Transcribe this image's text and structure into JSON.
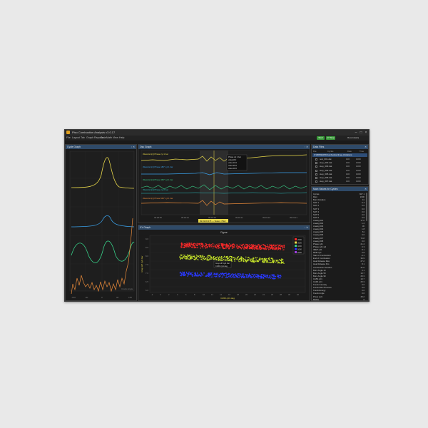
{
  "window": {
    "title": "Piso Combustion Analysis v3.0.17",
    "btn_start": "Start",
    "btn_stop": "17 Stop",
    "btn_recorder": "Recorder[1]"
  },
  "menu": [
    "File",
    "Layout",
    "Tab",
    "Graph Reports",
    "Data",
    "Math",
    "View",
    "Help"
  ],
  "left_panel": {
    "title": "Cycle Graph",
    "x_axis_label": "Crank Angle",
    "x_ticks": [
      "-180",
      "-90",
      "0",
      "90",
      "180"
    ]
  },
  "top_panel": {
    "title": "Osc Graph",
    "legends": [
      "Waveform[1] Phase cyl 1 bar",
      "Waveform[1] Phase 180° cyl 1 bar",
      "Waveform[1] Phase 360° cyl 1 bar",
      "Waveform[1] Phase cyl 2 bar",
      "Waveform[1] Phase 540° cyl 1 bar"
    ],
    "tooltip_lines": [
      "Phase cyl 1 bar",
      "value16.0",
      "value 16.0",
      "value 25.0",
      "value 18.0"
    ],
    "x_ticks": [
      "09:48:56",
      "09:49:01",
      "09:49:06",
      "09:49:11",
      "09:49:16",
      "09:49:21"
    ],
    "status_text": "09:49:06.375 — Status: 78Hz"
  },
  "xy_panel": {
    "title": "XY Graph",
    "chart_title": "Figure",
    "x_axis_label": "CA50 cyl1 deg",
    "y_axis_label": "Imep HP cyl1 bar",
    "legend": [
      "2000",
      "3000",
      "4000",
      "5000",
      "6000"
    ],
    "annotation": [
      "Imep HP cyl1 bar",
      "CA50 cyl1 deg"
    ],
    "y_ticks": [
      "9.0",
      "8.5",
      "8.0",
      "7.5",
      "7.0",
      "6.5",
      "6.0"
    ],
    "x_ticks": [
      "-2",
      "0",
      "2",
      "4",
      "6",
      "8",
      "10",
      "12",
      "14",
      "16",
      "18",
      "20",
      "22",
      "24",
      "26",
      "28",
      "30",
      "32"
    ]
  },
  "data_files": {
    "title": "Data Files",
    "columns": [
      "File",
      "Cycles",
      "Date",
      "Time"
    ],
    "folder": "C:\\RDS\\DATA\\Combustion\\Imep_Rotations",
    "files": [
      {
        "name": "test_001.dat",
        "cycles": "100",
        "box": "1000"
      },
      {
        "name": "step_002.dat",
        "cycles": "100",
        "box": "1000"
      },
      {
        "name": "step_003.dat",
        "cycles": "100",
        "box": "1000"
      },
      {
        "name": "step_004.dat",
        "cycles": "100",
        "box": "1000"
      },
      {
        "name": "step_005.dat",
        "cycles": "100",
        "box": "1000"
      },
      {
        "name": "step_006.dat",
        "cycles": "100",
        "box": "1000"
      },
      {
        "name": "step_007.dat",
        "cycles": "100",
        "box": "1000"
      }
    ]
  },
  "channels": {
    "title": "Main Values for Cycles",
    "items": [
      {
        "name": "Cycles",
        "value": "827.1"
      },
      {
        "name": "Rpm",
        "value": "2000"
      },
      {
        "name": "Burn Duration",
        "value": "41"
      },
      {
        "name": "SOT 1",
        "value": "9.4"
      },
      {
        "name": "SOT 2",
        "value": "0.0"
      },
      {
        "name": "SOT 3",
        "value": "0.0"
      },
      {
        "name": "SOT 4",
        "value": "0.0"
      },
      {
        "name": "SOT 5",
        "value": "0.0"
      },
      {
        "name": "SOT 6",
        "value": "0.0"
      },
      {
        "name": "Analog 001",
        "value": "17.0"
      },
      {
        "name": "Analog 002",
        "value": "1.2"
      },
      {
        "name": "Analog 003",
        "value": "30"
      },
      {
        "name": "Analog 004",
        "value": "1.8"
      },
      {
        "name": "Analog 005",
        "value": "61"
      },
      {
        "name": "Analog 006",
        "value": "0.0"
      },
      {
        "name": "Analog 007",
        "value": "72.8"
      },
      {
        "name": "Analog 008",
        "value": "0.0"
      },
      {
        "name": "Phase cyl1",
        "value": "21.4"
      },
      {
        "name": "Phase cyl1 std",
        "value": "0.3"
      },
      {
        "name": "IMEP cyl1",
        "value": "8.1"
      },
      {
        "name": "MFB cyl1",
        "value": "0.8"
      },
      {
        "name": "Start of Combustion",
        "value": "-4.1"
      },
      {
        "name": "End of Combustion",
        "value": "36.9"
      },
      {
        "name": "Heat Release Max",
        "value": "27.2"
      },
      {
        "name": "Heat Release Pos",
        "value": "8.1"
      },
      {
        "name": "Combustion Duration",
        "value": "41.0"
      },
      {
        "name": "Burn Angle 10",
        "value": "0.1"
      },
      {
        "name": "Burn Angle 50",
        "value": "10.7"
      },
      {
        "name": "Burn Angle 90",
        "value": "25.3"
      },
      {
        "name": "CA50 cyl1",
        "value": "10.7"
      },
      {
        "name": "CA90 cyl1",
        "value": "25.3"
      },
      {
        "name": "Knock Intensity",
        "value": "0.0"
      },
      {
        "name": "Knock Max Pressure",
        "value": "0.0"
      },
      {
        "name": "Knock Energy",
        "value": "0.0"
      },
      {
        "name": "Knock Angle",
        "value": "0.0"
      },
      {
        "name": "Pmax cyl1",
        "value": "45.2"
      },
      {
        "name": "Misfire",
        "value": "0"
      }
    ]
  },
  "colors": {
    "yellow": "#e8d84a",
    "blue": "#3aa0e8",
    "green": "#38d088",
    "orange": "#e88a3a",
    "red": "#ff2a2a",
    "yellow_green": "#c8e62a",
    "dark_blue": "#2a3aff",
    "purple": "#a040e0",
    "header": "#2f4a68"
  }
}
